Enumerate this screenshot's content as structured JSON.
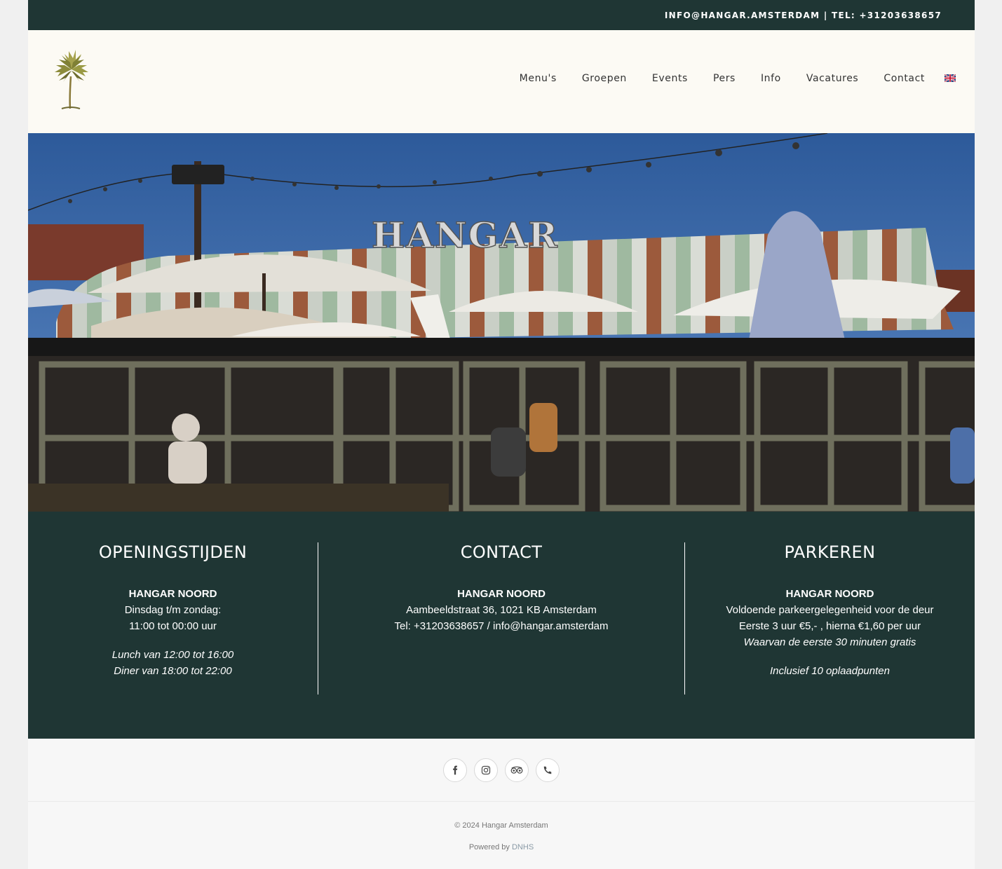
{
  "topbar": {
    "contact_line": "INFO@HANGAR.AMSTERDAM | TEL: +31203638657"
  },
  "header": {
    "logo": {
      "icon": "palm-tree-icon"
    },
    "nav": [
      "Menu's",
      "Groepen",
      "Events",
      "Pers",
      "Info",
      "Vacatures",
      "Contact"
    ],
    "language_flag": {
      "icon": "uk-flag-icon"
    }
  },
  "hero": {
    "sign_text": "HANGAR"
  },
  "info": {
    "hours": {
      "title": "OPENINGSTIJDEN",
      "location": "HANGAR NOORD",
      "days": "Dinsdag t/m zondag:",
      "times": "11:00 tot 00:00 uur",
      "lunch": "Lunch van 12:00 tot 16:00",
      "dinner": "Diner van 18:00 tot 22:00"
    },
    "contact": {
      "title": "CONTACT",
      "location": "HANGAR NOORD",
      "address": "Aambeeldstraat 36, 1021 KB Amsterdam",
      "phone_email": "Tel: +31203638657 / info@hangar.amsterdam"
    },
    "parking": {
      "title": "PARKEREN",
      "location": "HANGAR NOORD",
      "line1": "Voldoende parkeergelegenheid voor de deur",
      "line2": "Eerste 3 uur €5,- , hierna €1,60 per uur",
      "line3": "Waarvan de eerste 30 minuten gratis",
      "line4": "Inclusief 10 oplaadpunten"
    }
  },
  "social": [
    {
      "icon": "facebook-icon"
    },
    {
      "icon": "instagram-icon"
    },
    {
      "icon": "tripadvisor-icon"
    },
    {
      "icon": "phone-icon"
    }
  ],
  "footer": {
    "copyright": "© 2024 Hangar Amsterdam",
    "powered_by": "Powered by",
    "powered_link": "DNHS"
  },
  "colors": {
    "dark_green": "#1f3634",
    "cream": "#fcfaf4",
    "footer_bg": "#f7f7f7"
  }
}
